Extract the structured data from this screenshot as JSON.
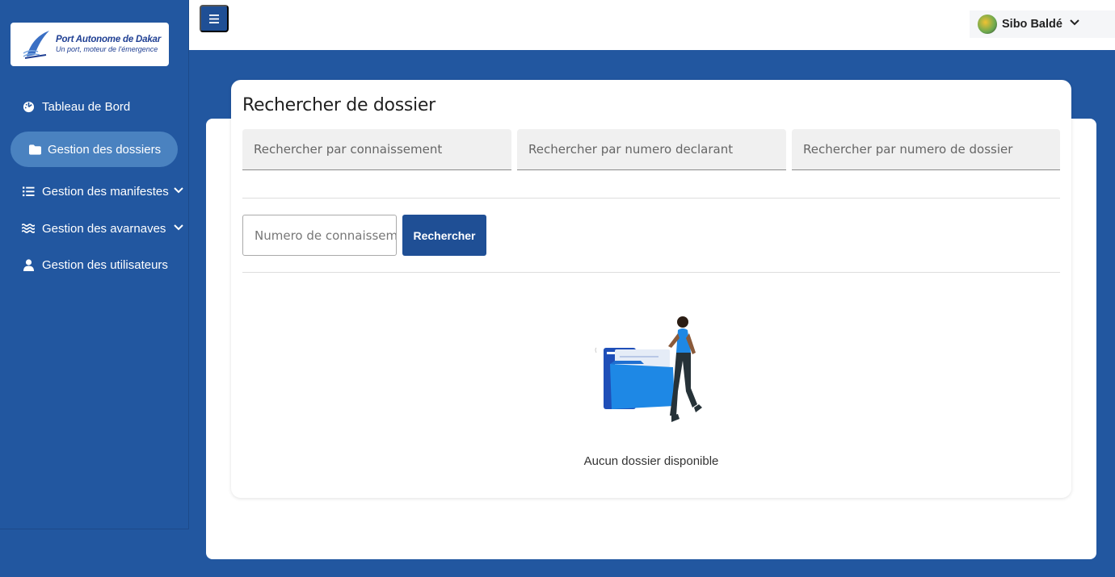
{
  "brand": {
    "title": "Port Autonome de Dakar",
    "tagline": "Un port, moteur de l'émergence"
  },
  "sidebar": {
    "items": [
      {
        "label": "Tableau de Bord",
        "icon": "dashboard-icon",
        "active": false,
        "expandable": false
      },
      {
        "label": "Gestion des dossiers",
        "icon": "folder-icon",
        "active": true,
        "expandable": false
      },
      {
        "label": "Gestion des manifestes",
        "icon": "list-icon",
        "active": false,
        "expandable": true
      },
      {
        "label": "Gestion des avarnaves",
        "icon": "waves-icon",
        "active": false,
        "expandable": true
      },
      {
        "label": "Gestion des utilisateurs",
        "icon": "user-icon",
        "active": false,
        "expandable": false
      }
    ]
  },
  "header": {
    "user_name": "Sibo Baldé"
  },
  "search": {
    "title": "Rechercher de dossier",
    "filters": [
      {
        "placeholder": "Rechercher par connaissement"
      },
      {
        "placeholder": "Rechercher par numero declarant"
      },
      {
        "placeholder": "Rechercher par numero de dossier"
      }
    ],
    "number_placeholder": "Numero de connaissement",
    "button_label": "Rechercher"
  },
  "empty_state": {
    "message": "Aucun dossier disponible"
  },
  "colors": {
    "primary": "#2257a0",
    "button": "#1f4f95",
    "active_nav": "#4a82c0"
  }
}
